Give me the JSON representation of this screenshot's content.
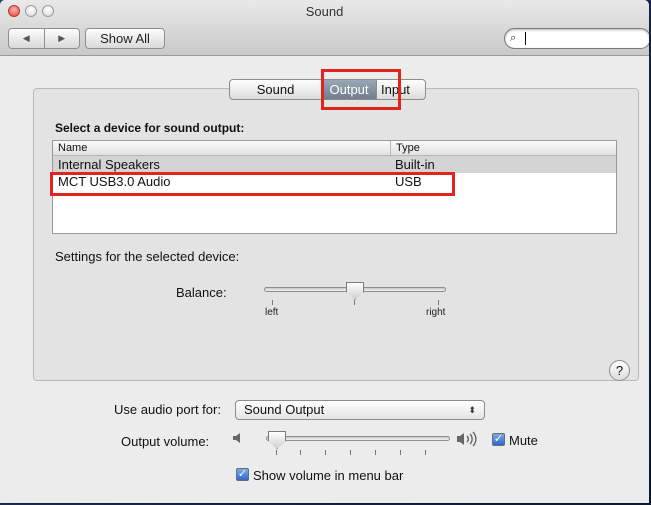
{
  "window": {
    "title": "Sound"
  },
  "toolbar": {
    "back_glyph": "◀",
    "forward_glyph": "▶",
    "show_all_label": "Show All",
    "search_glyph": "🔍",
    "search_value": ""
  },
  "tabs": [
    {
      "label": "Sound Effects",
      "active": false
    },
    {
      "label": "Output",
      "active": true
    },
    {
      "label": "Input",
      "active": false
    }
  ],
  "output": {
    "select_device_title": "Select a device for sound output:",
    "columns": [
      "Name",
      "Type"
    ],
    "devices": [
      {
        "name": "Internal Speakers",
        "type": "Built-in",
        "selected": true
      },
      {
        "name": "MCT USB3.0 Audio",
        "type": "USB",
        "selected": false
      }
    ],
    "settings_label": "Settings for the selected device:",
    "balance_label": "Balance:",
    "balance_left": "left",
    "balance_right": "right",
    "balance_value": 0.5,
    "help_glyph": "?"
  },
  "bottom": {
    "audio_port_label": "Use audio port for:",
    "audio_port_value": "Sound Output",
    "audio_port_arrows": "⬍",
    "volume_label": "Output volume:",
    "volume_value": 0.05,
    "mute_label": "Mute",
    "mute_checked": true,
    "show_in_menu_label": "Show volume in menu bar",
    "show_in_menu_checked": true
  },
  "highlight_color": "#e0251f",
  "accent_color": "#2e6ac7"
}
